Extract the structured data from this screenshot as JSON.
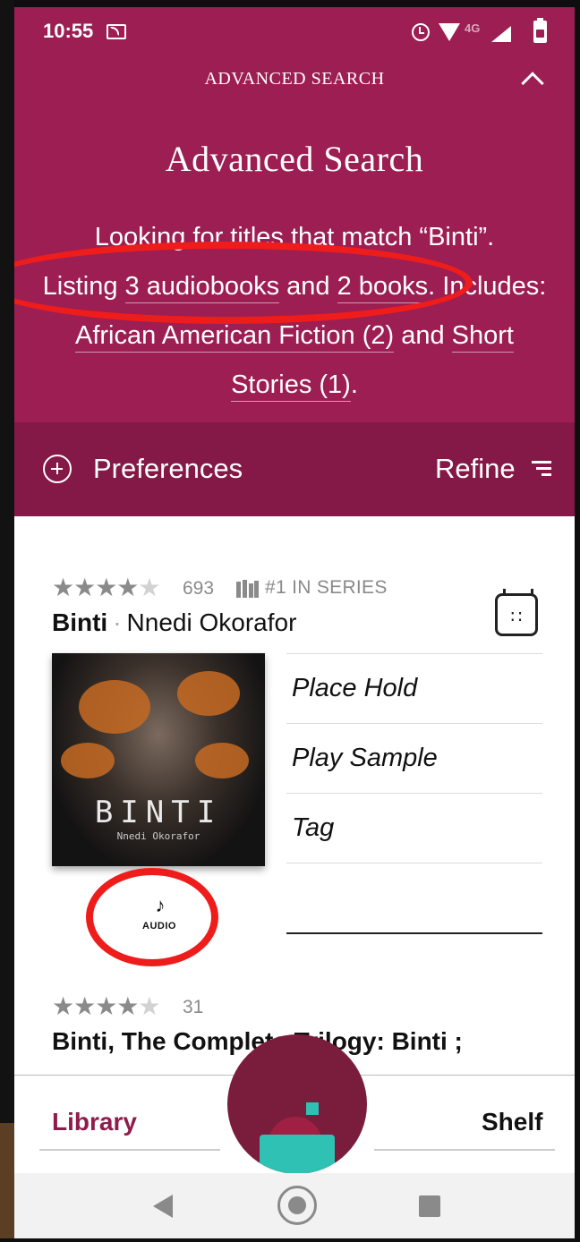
{
  "status_bar": {
    "time": "10:55",
    "network": "4G",
    "icons": [
      "cast-icon",
      "alarm-icon",
      "wifi-icon",
      "signal-icon",
      "battery-icon"
    ]
  },
  "header": {
    "title": "ADVANCED SEARCH",
    "collapse_icon": "chevron-up-icon"
  },
  "search_summary": {
    "heading": "Advanced Search",
    "line1": "Looking for titles that match “Binti”.",
    "listing_prefix": "Listing ",
    "audiobooks_link": "3 audiobooks",
    "and_text": " and ",
    "books_link": "2 books",
    "includes_text": ". Includes:",
    "genre1_link": "African American Fiction (2)",
    "and_text2": " and ",
    "genre2_link_a": "Short",
    "genre2_link_b": "Stories (1)",
    "period": "."
  },
  "toolbar": {
    "preferences_label": "Preferences",
    "refine_label": "Refine"
  },
  "results": [
    {
      "rating_count": "693",
      "series": "#1 IN SERIES",
      "title": "Binti",
      "separator": "·",
      "author": "Nnedi Okorafor",
      "cover_title": "BINTI",
      "cover_author": "Nnedi Okorafor",
      "actions": [
        "Place Hold",
        "Play Sample",
        "Tag"
      ],
      "format": "AUDIO"
    },
    {
      "rating_count": "31",
      "title": "Binti, The Complete Trilogy: Binti ;"
    }
  ],
  "bottom_nav": {
    "library": "Library",
    "shelf": "Shelf"
  },
  "colors": {
    "brand": "#9c1e52",
    "brand_dark": "#841847",
    "annotation": "#ef1c1c",
    "libby_teal": "#2fc2b4"
  }
}
